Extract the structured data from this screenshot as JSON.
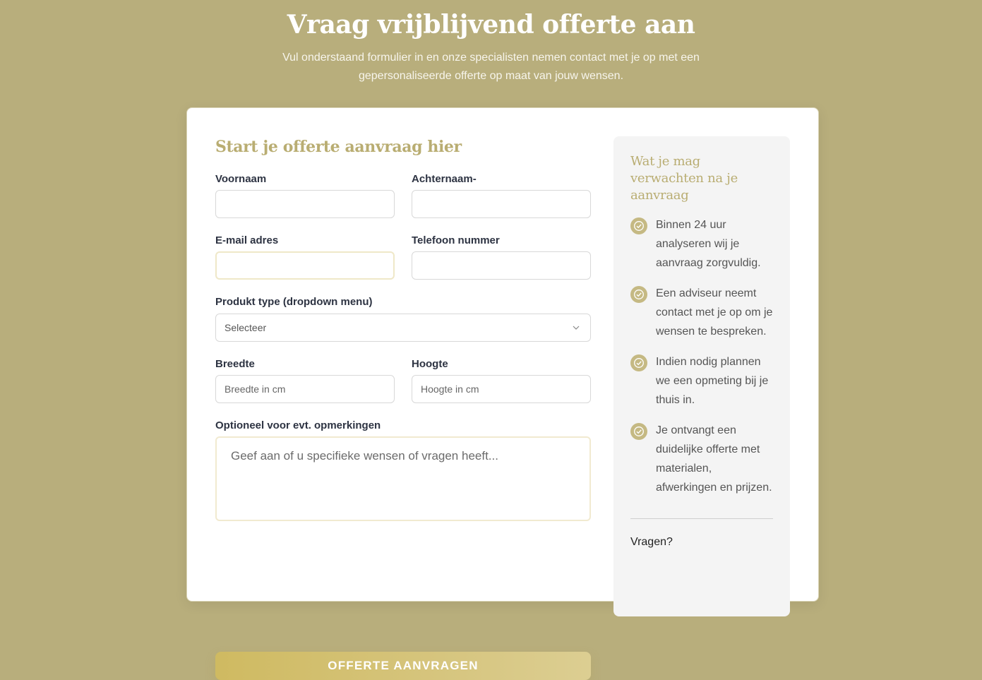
{
  "hero": {
    "title": "Vraag vrijblijvend offerte aan",
    "subtitle": "Vul onderstaand formulier in en onze specialisten nemen contact met je op met een gepersonaliseerde offerte op maat van jouw wensen."
  },
  "form": {
    "heading": "Start je offerte aanvraag hier",
    "first_name_label": "Voornaam",
    "last_name_label": "Achternaam-",
    "email_label": "E-mail adres",
    "phone_label": "Telefoon nummer",
    "product_label": "Produkt type (dropdown menu)",
    "product_selected": "Selecteer",
    "width_label": "Breedte",
    "width_placeholder": "Breedte in cm",
    "height_label": "Hoogte",
    "height_placeholder": "Hoogte in cm",
    "remarks_label": "Optioneel voor evt. opmerkingen",
    "remarks_placeholder": "Geef aan of u specifieke wensen of vragen heeft...",
    "submit_label": "OFFERTE AANVRAGEN"
  },
  "sidebar": {
    "heading": "Wat je mag verwachten na je aanvraag",
    "items": [
      {
        "icon": "check-circle-icon",
        "text": "Binnen 24 uur analyseren wij je aanvraag zorgvuldig."
      },
      {
        "icon": "check-circle-icon",
        "text": "Een adviseur neemt contact met je op om je wensen te bespreken."
      },
      {
        "icon": "check-circle-icon",
        "text": "Indien nodig plannen we een opmeting bij je thuis in."
      },
      {
        "icon": "check-circle-icon",
        "text": "Je ontvangt een duidelijke offerte met materialen, afwerkingen en prijzen."
      }
    ],
    "questions_label": "Vragen?"
  },
  "colors": {
    "background": "#b8ae7c",
    "accent": "#b9ad72",
    "button": "#d4c06f"
  }
}
